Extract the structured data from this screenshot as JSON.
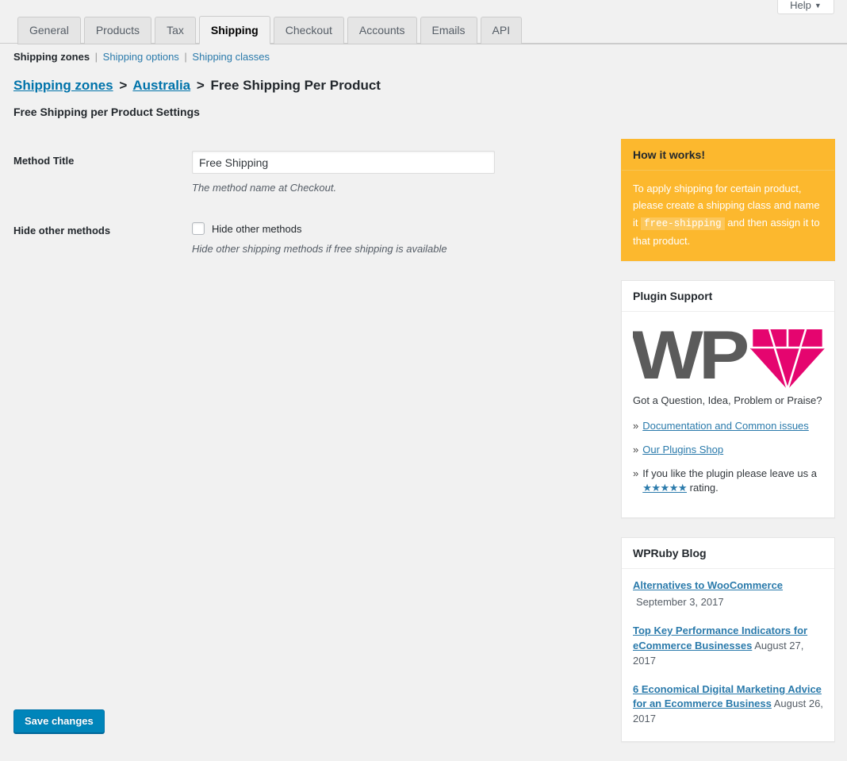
{
  "help": {
    "label": "Help",
    "caret": "▼"
  },
  "tabs": [
    {
      "label": "General",
      "active": false
    },
    {
      "label": "Products",
      "active": false
    },
    {
      "label": "Tax",
      "active": false
    },
    {
      "label": "Shipping",
      "active": true
    },
    {
      "label": "Checkout",
      "active": false
    },
    {
      "label": "Accounts",
      "active": false
    },
    {
      "label": "Emails",
      "active": false
    },
    {
      "label": "API",
      "active": false
    }
  ],
  "subnav": {
    "current": "Shipping zones",
    "separator": "|",
    "links": [
      "Shipping options",
      "Shipping classes"
    ]
  },
  "breadcrumb": {
    "link1": "Shipping zones",
    "link2": "Australia",
    "current": "Free Shipping Per Product",
    "separator": ">"
  },
  "section_title": "Free Shipping per Product Settings",
  "form": {
    "method_title": {
      "label": "Method Title",
      "value": "Free Shipping",
      "placeholder": "",
      "description": "The method name at Checkout."
    },
    "hide_other_methods": {
      "label": "Hide other methods",
      "checkbox_label": "Hide other methods",
      "checked": false,
      "description": "Hide other shipping methods if free shipping is available"
    }
  },
  "sidebar": {
    "how_it_works": {
      "title": "How it works!",
      "text_before": "To apply shipping for certain product, please create a shipping class and name it",
      "code": "free-shipping",
      "text_after": "and then assign it to that product."
    },
    "plugin_support": {
      "title": "Plugin Support",
      "logo_text": "WP",
      "logo_icon": "diamond-icon",
      "lead": "Got a Question, Idea, Problem or Praise?",
      "bullet": "»",
      "items": [
        {
          "type": "link",
          "label": "Documentation and Common issues"
        },
        {
          "type": "link",
          "label": "Our Plugins Shop"
        },
        {
          "type": "rating",
          "text_before": "If you like the plugin please leave us a",
          "stars": "★★★★★",
          "text_after": "rating."
        }
      ]
    },
    "blog": {
      "title": "WPRuby Blog",
      "posts": [
        {
          "title": "Alternatives to WooCommerce",
          "date": "September 3, 2017",
          "date_below": true
        },
        {
          "title": "Top Key Performance Indicators for eCommerce Businesses",
          "date": "August 27, 2017",
          "date_below": false
        },
        {
          "title": "6 Economical Digital Marketing Advice for an Ecommerce Business",
          "date": "August 26, 2017",
          "date_below": false
        }
      ]
    }
  },
  "save_button": {
    "label": "Save changes"
  },
  "colors": {
    "accent_blue": "#0085ba",
    "link_blue": "#2a7aab",
    "breadcrumb_link": "#0073aa",
    "orange_panel": "#fcb82e",
    "logo_gray": "#5b5b5b",
    "logo_pink": "#e5056f",
    "page_bg": "#f1f1f1"
  }
}
